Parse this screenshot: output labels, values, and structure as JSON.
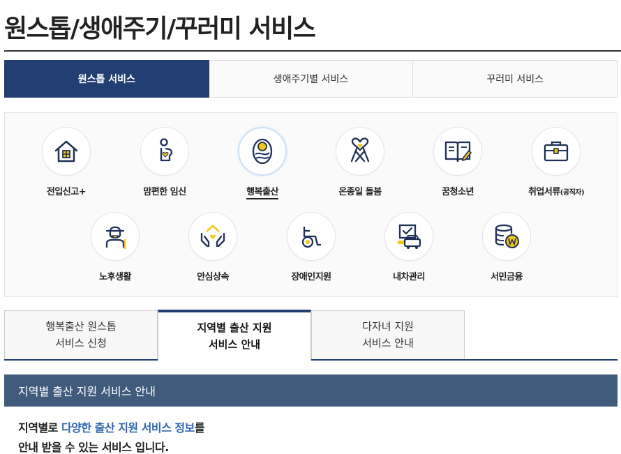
{
  "page": {
    "title": "원스톱/생애주기/꾸러미 서비스"
  },
  "main_tabs": [
    {
      "label": "원스톱 서비스",
      "active": true
    },
    {
      "label": "생애주기별 서비스",
      "active": false
    },
    {
      "label": "꾸러미 서비스",
      "active": false
    }
  ],
  "services": [
    {
      "label": "전입신고+",
      "icon": "house-icon"
    },
    {
      "label": "맘편한 임신",
      "icon": "pregnant-woman-icon"
    },
    {
      "label": "행복출산",
      "icon": "newborn-baby-icon",
      "active": true
    },
    {
      "label": "온종일 돌봄",
      "icon": "heart-ribbon-icon"
    },
    {
      "label": "꿈청소년",
      "icon": "open-book-icon"
    },
    {
      "label": "취업서류",
      "label_small": "(공직자)",
      "icon": "briefcase-icon"
    },
    {
      "label": "노후생활",
      "icon": "elderly-man-icon"
    },
    {
      "label": "안심상속",
      "icon": "hands-house-icon"
    },
    {
      "label": "장애인지원",
      "icon": "wheelchair-icon"
    },
    {
      "label": "내차관리",
      "icon": "car-document-icon"
    },
    {
      "label": "서민금융",
      "icon": "coins-icon"
    }
  ],
  "sub_tabs": [
    {
      "line1": "행복출산 원스톱",
      "line2": "서비스 신청",
      "active": false
    },
    {
      "line1": "지역별 출산 지원",
      "line2": "서비스 안내",
      "active": true
    },
    {
      "line1": "다자녀 지원",
      "line2": "서비스 안내",
      "active": false
    }
  ],
  "info": {
    "header": "지역별 출산 지원 서비스 안내",
    "text_prefix": "지역별로 ",
    "text_highlight": "다양한 출산 지원 서비스 정보",
    "text_suffix": "를",
    "text_line2": "안내 받을 수 있는 서비스 입니다."
  },
  "colors": {
    "navy": "#223e72",
    "accent_yellow": "#f5c518",
    "highlight_blue": "#2e66b1",
    "info_header": "#415b7d"
  }
}
